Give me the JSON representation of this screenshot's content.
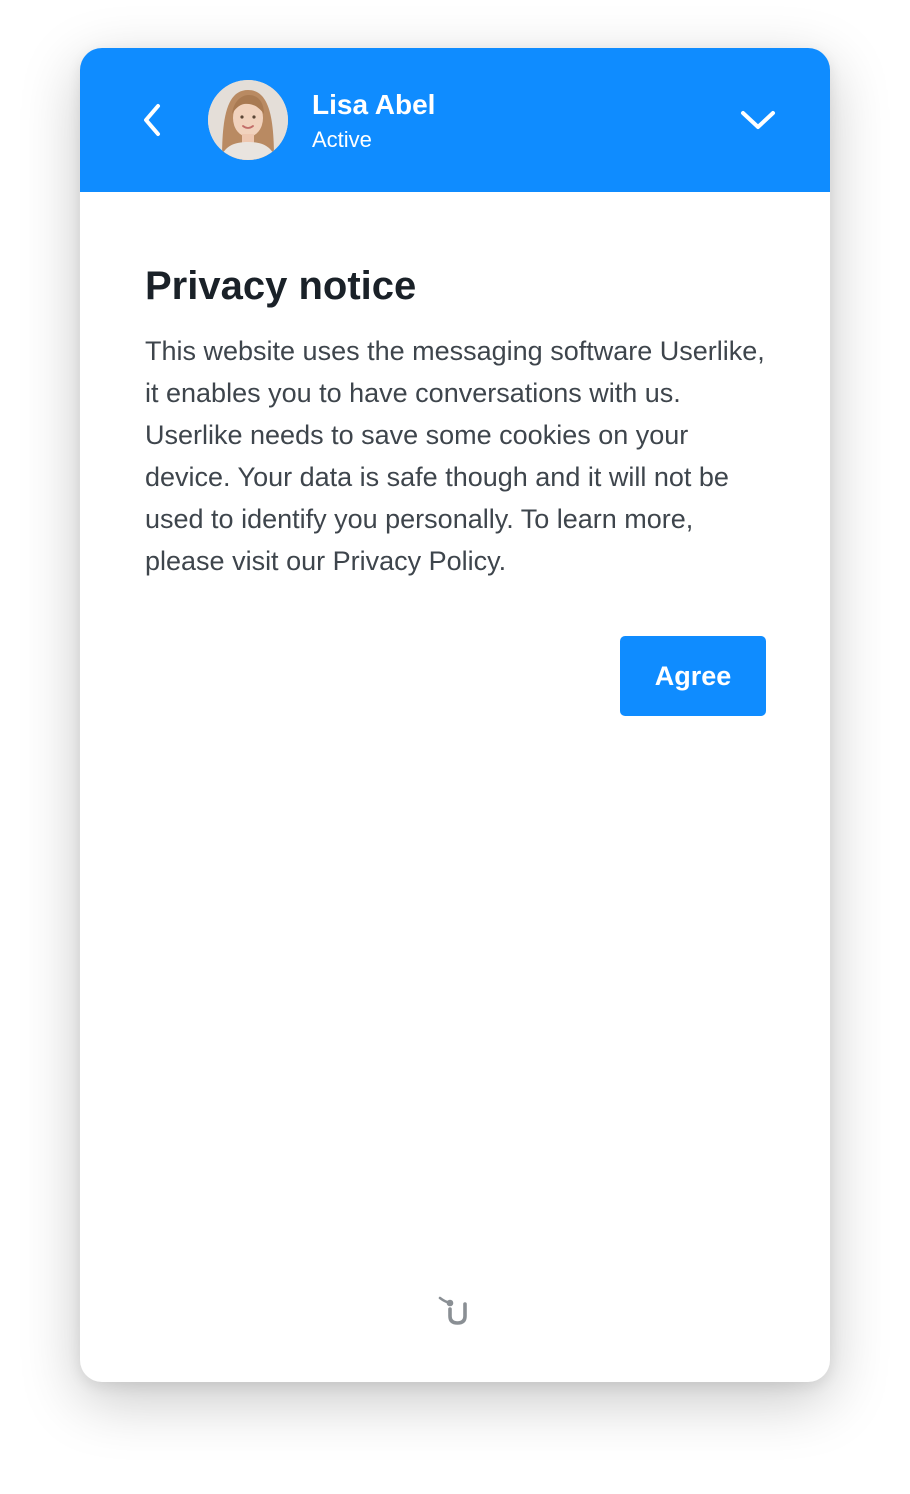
{
  "header": {
    "agent_name": "Lisa Abel",
    "agent_status": "Active",
    "back_icon": "chevron-left-icon",
    "minimize_icon": "chevron-down-icon",
    "background_color": "#0f8cff"
  },
  "privacy_notice": {
    "title": "Privacy notice",
    "body": "This website uses the messaging software Userlike, it enables you to have conversations with us. Userlike needs to save some cookies on your device. Your data is safe though and it will not be used to identify you personally. To learn more, please visit our Privacy Policy.",
    "agree_label": "Agree"
  },
  "footer": {
    "logo_icon": "userlike-logo-icon"
  },
  "colors": {
    "accent": "#0f8cff",
    "title_text": "#1a2128",
    "body_text": "#3e454c"
  }
}
